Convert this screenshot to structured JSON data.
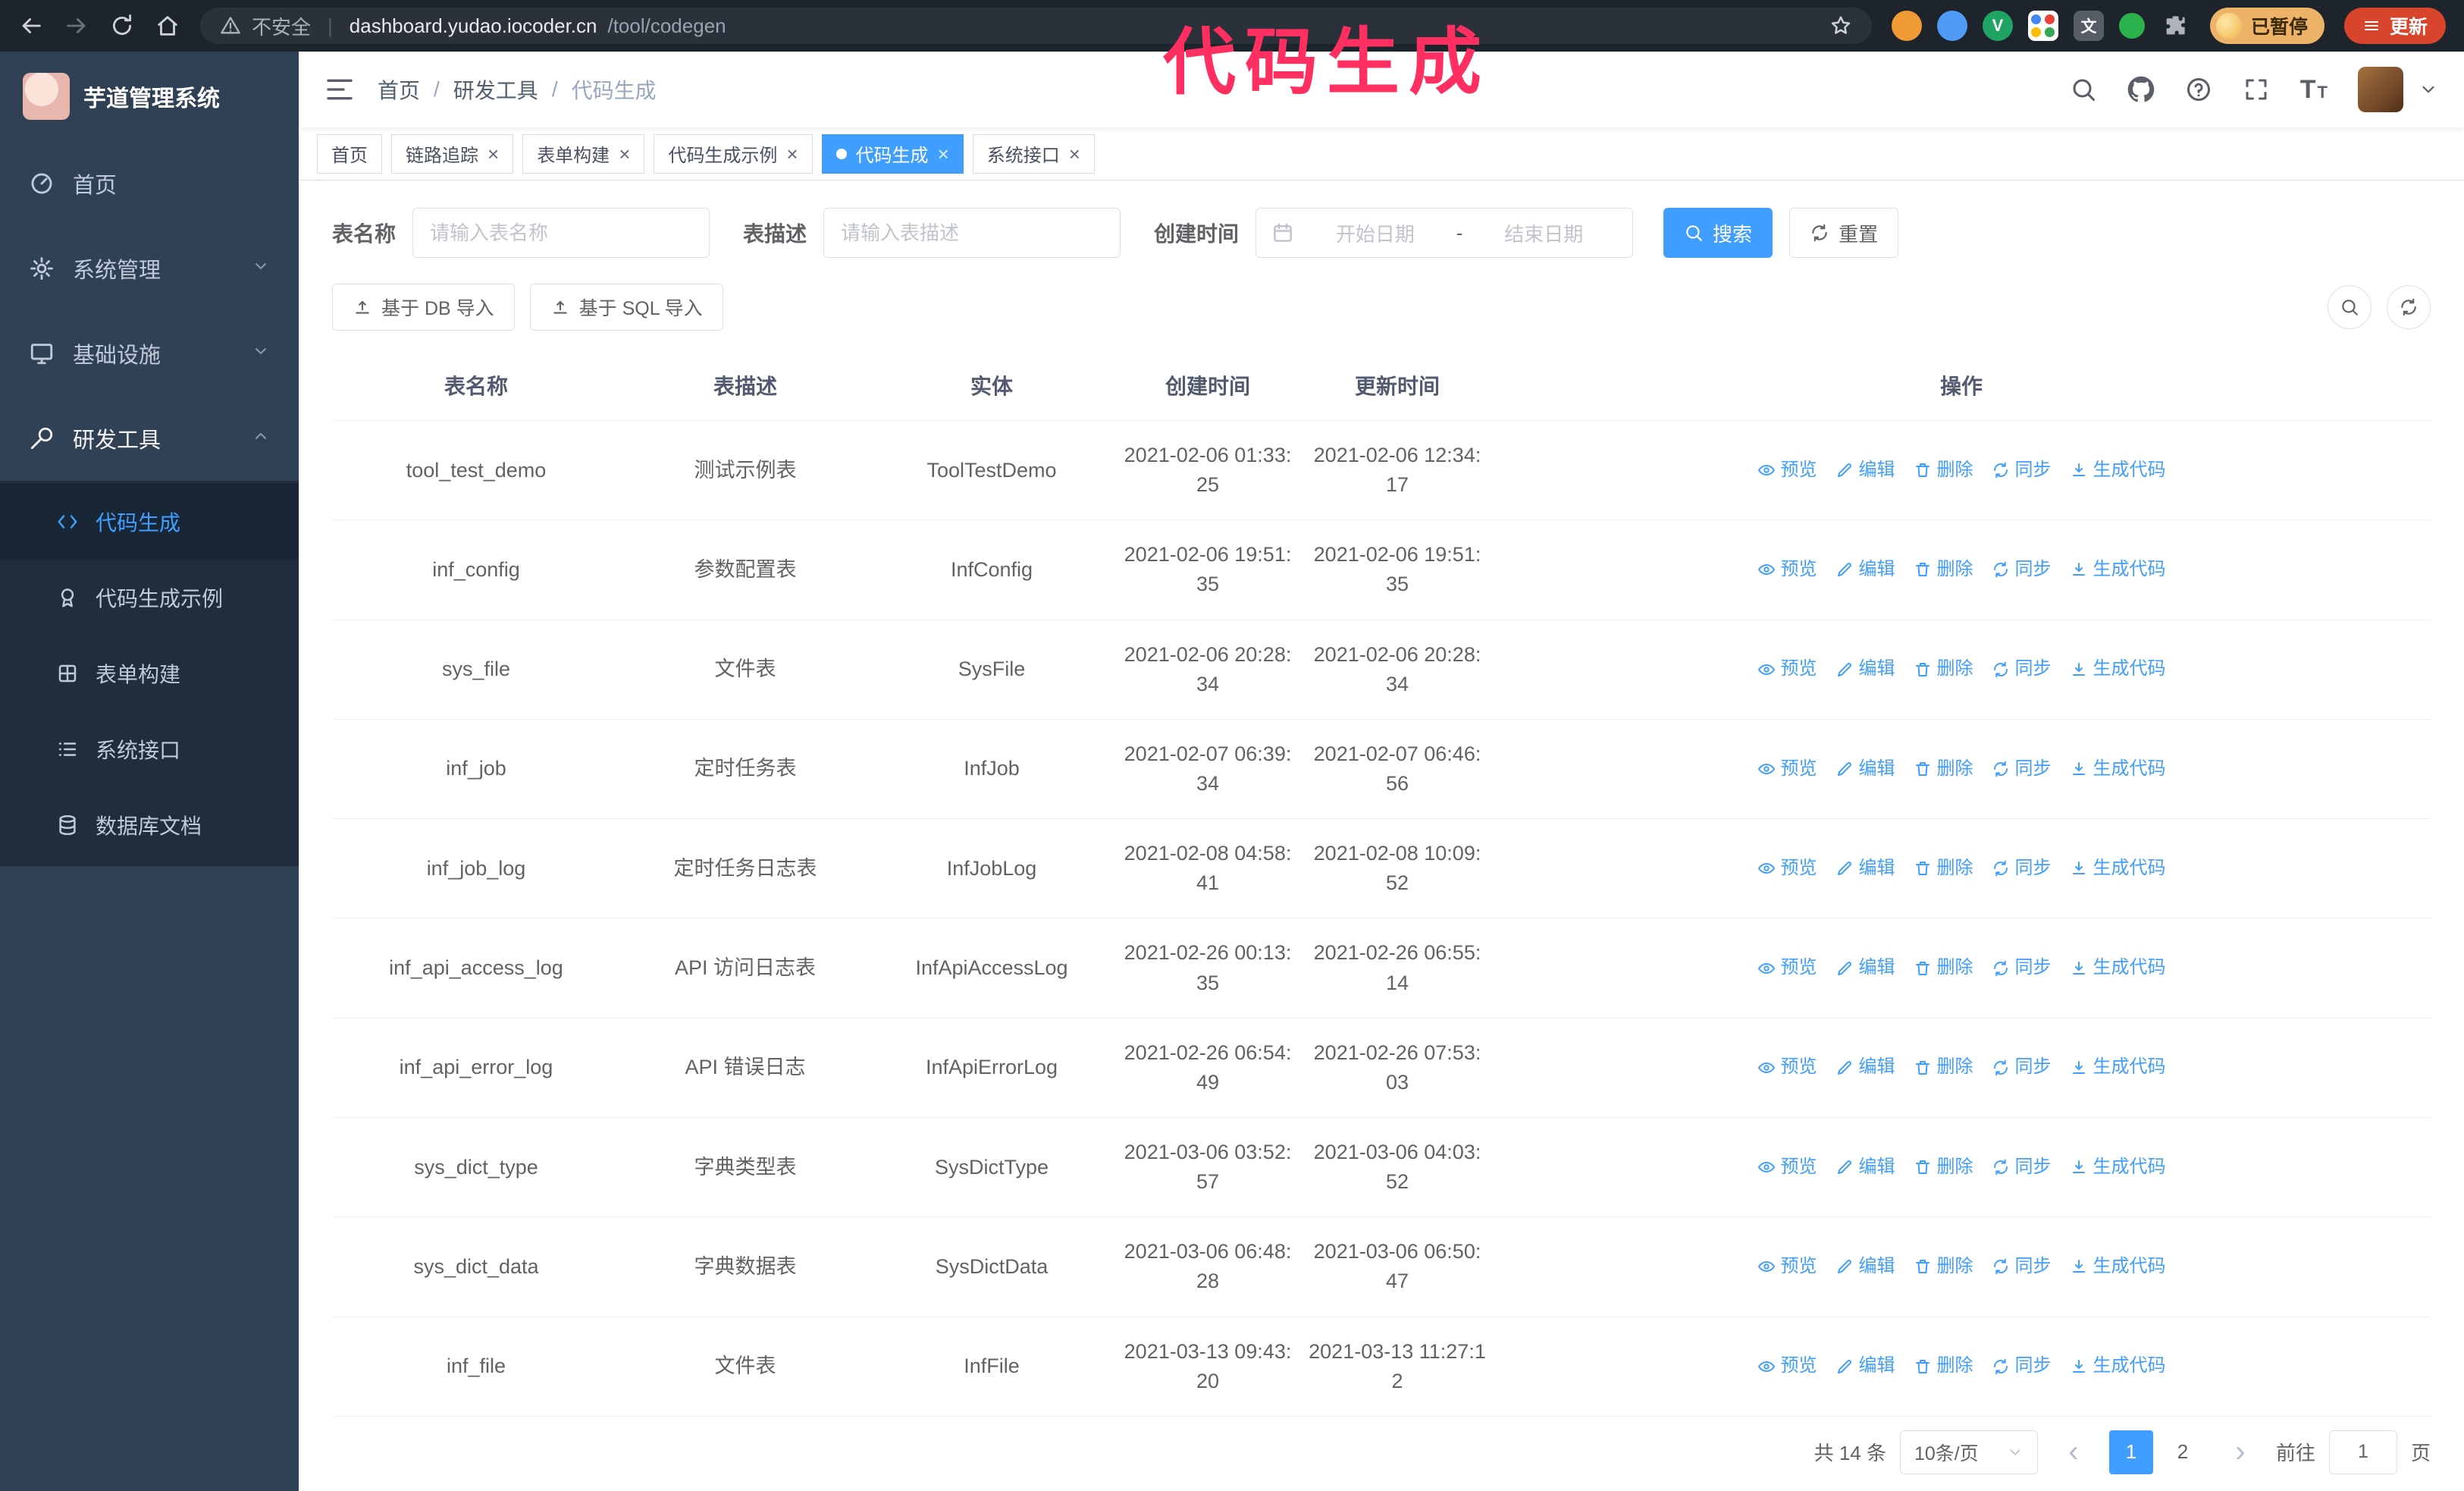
{
  "browser": {
    "security_label": "不安全",
    "url_host": "dashboard.yudao.iocoder.cn",
    "url_path": "/tool/codegen",
    "profile_badge": "已暂停",
    "update_button": "更新",
    "extension_glyphs": {
      "v": "V",
      "translate": "文"
    }
  },
  "annotation": {
    "text": "代码生成",
    "color": "#ff2f62"
  },
  "sidebar": {
    "logo_title": "芋道管理系统",
    "menu": [
      {
        "label": "首页",
        "icon": "dashboard-icon",
        "type": "item",
        "expanded": false
      },
      {
        "label": "系统管理",
        "icon": "gear-icon",
        "type": "group",
        "expanded": false
      },
      {
        "label": "基础设施",
        "icon": "monitor-icon",
        "type": "group",
        "expanded": false
      },
      {
        "label": "研发工具",
        "icon": "wrench-icon",
        "type": "group",
        "expanded": true
      }
    ],
    "submenu": [
      {
        "label": "代码生成",
        "icon": "code-icon",
        "active": true
      },
      {
        "label": "代码生成示例",
        "icon": "badge-icon",
        "active": false
      },
      {
        "label": "表单构建",
        "icon": "form-grid-icon",
        "active": false
      },
      {
        "label": "系统接口",
        "icon": "list-icon",
        "active": false
      },
      {
        "label": "数据库文档",
        "icon": "database-icon",
        "active": false
      }
    ]
  },
  "header": {
    "breadcrumb": [
      "首页",
      "研发工具",
      "代码生成"
    ]
  },
  "tabs": [
    {
      "label": "首页",
      "closable": false,
      "active": false
    },
    {
      "label": "链路追踪",
      "closable": true,
      "active": false
    },
    {
      "label": "表单构建",
      "closable": true,
      "active": false
    },
    {
      "label": "代码生成示例",
      "closable": true,
      "active": false
    },
    {
      "label": "代码生成",
      "closable": true,
      "active": true
    },
    {
      "label": "系统接口",
      "closable": true,
      "active": false
    }
  ],
  "filters": {
    "table_name_label": "表名称",
    "table_name_placeholder": "请输入表名称",
    "table_desc_label": "表描述",
    "table_desc_placeholder": "请输入表描述",
    "create_time_label": "创建时间",
    "date_start_placeholder": "开始日期",
    "date_separator": "-",
    "date_end_placeholder": "结束日期",
    "search_button": "搜索",
    "reset_button": "重置"
  },
  "toolbar": {
    "import_db": "基于 DB 导入",
    "import_sql": "基于 SQL 导入"
  },
  "table": {
    "columns": [
      "表名称",
      "表描述",
      "实体",
      "创建时间",
      "更新时间",
      "操作"
    ],
    "actions": [
      {
        "name": "preview",
        "label": "预览",
        "icon": "eye-icon"
      },
      {
        "name": "edit",
        "label": "编辑",
        "icon": "edit-icon"
      },
      {
        "name": "delete",
        "label": "删除",
        "icon": "delete-icon"
      },
      {
        "name": "sync",
        "label": "同步",
        "icon": "sync-icon"
      },
      {
        "name": "generate",
        "label": "生成代码",
        "icon": "download-icon"
      }
    ],
    "rows": [
      {
        "name": "tool_test_demo",
        "desc": "测试示例表",
        "entity": "ToolTestDemo",
        "created": "2021-02-06 01:33:25",
        "updated": "2021-02-06 12:34:17"
      },
      {
        "name": "inf_config",
        "desc": "参数配置表",
        "entity": "InfConfig",
        "created": "2021-02-06 19:51:35",
        "updated": "2021-02-06 19:51:35"
      },
      {
        "name": "sys_file",
        "desc": "文件表",
        "entity": "SysFile",
        "created": "2021-02-06 20:28:34",
        "updated": "2021-02-06 20:28:34"
      },
      {
        "name": "inf_job",
        "desc": "定时任务表",
        "entity": "InfJob",
        "created": "2021-02-07 06:39:34",
        "updated": "2021-02-07 06:46:56"
      },
      {
        "name": "inf_job_log",
        "desc": "定时任务日志表",
        "entity": "InfJobLog",
        "created": "2021-02-08 04:58:41",
        "updated": "2021-02-08 10:09:52"
      },
      {
        "name": "inf_api_access_log",
        "desc": "API 访问日志表",
        "entity": "InfApiAccessLog",
        "created": "2021-02-26 00:13:35",
        "updated": "2021-02-26 06:55:14"
      },
      {
        "name": "inf_api_error_log",
        "desc": "API 错误日志",
        "entity": "InfApiErrorLog",
        "created": "2021-02-26 06:54:49",
        "updated": "2021-02-26 07:53:03"
      },
      {
        "name": "sys_dict_type",
        "desc": "字典类型表",
        "entity": "SysDictType",
        "created": "2021-03-06 03:52:57",
        "updated": "2021-03-06 04:03:52"
      },
      {
        "name": "sys_dict_data",
        "desc": "字典数据表",
        "entity": "SysDictData",
        "created": "2021-03-06 06:48:28",
        "updated": "2021-03-06 06:50:47"
      },
      {
        "name": "inf_file",
        "desc": "文件表",
        "entity": "InfFile",
        "created": "2021-03-13 09:43:20",
        "updated": "2021-03-13 11:27:12"
      }
    ]
  },
  "pagination": {
    "total_text": "共 14 条",
    "page_size": "10条/页",
    "pages": [
      "1",
      "2"
    ],
    "active_page": "1",
    "goto_label": "前往",
    "goto_value": "1",
    "page_unit": "页"
  },
  "colors": {
    "primary": "#409eff",
    "sidebar_bg": "#304156",
    "submenu_bg": "#1f2d3d",
    "annotation": "#ff2f62"
  }
}
